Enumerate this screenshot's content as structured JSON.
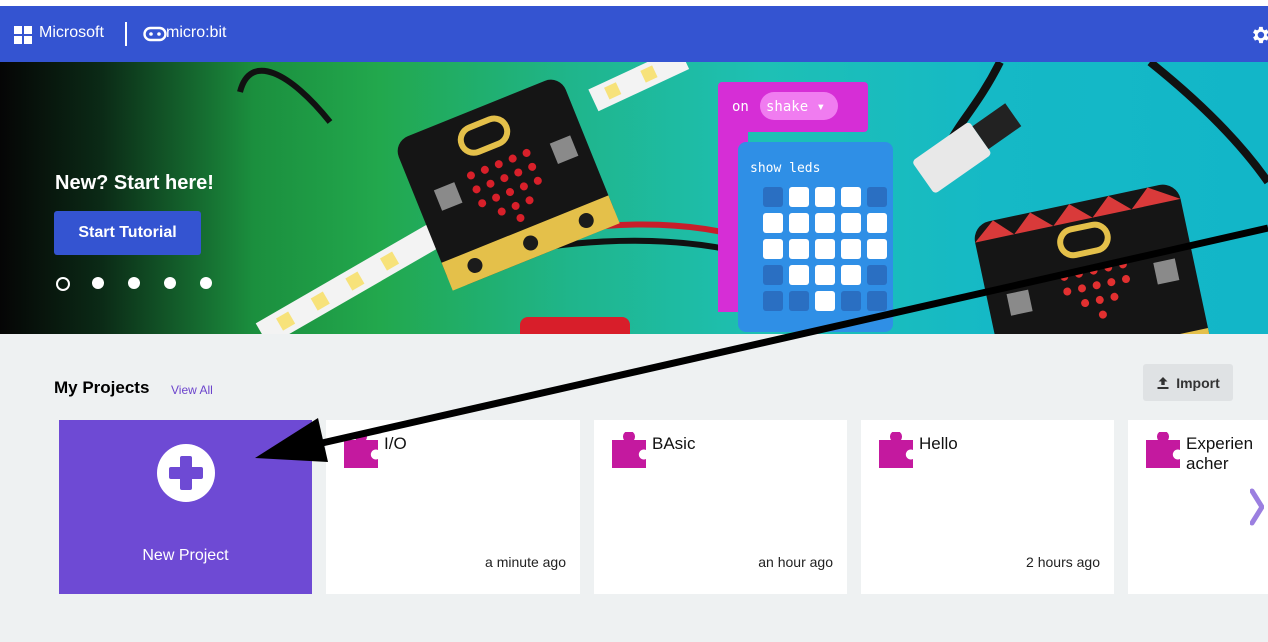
{
  "header": {
    "microsoft_label": "Microsoft",
    "microbit_label": "micro:bit",
    "settings_icon": "gear-icon"
  },
  "hero": {
    "title": "New? Start here!",
    "button_label": "Start Tutorial",
    "carousel_dots": 5,
    "active_dot": 0
  },
  "projects": {
    "title": "My Projects",
    "view_all": "View All",
    "import_label": "Import",
    "new_project_label": "New Project",
    "cards": [
      {
        "name": "I/O",
        "time": "a minute ago"
      },
      {
        "name": "BAsic",
        "time": "an hour ago"
      },
      {
        "name": "Hello",
        "time": "2 hours ago"
      },
      {
        "name": "Experien acher",
        "time": ""
      }
    ]
  },
  "colors": {
    "header": "#3454d1",
    "new_project": "#6e4ad4",
    "puzzle": "#c4199f"
  }
}
